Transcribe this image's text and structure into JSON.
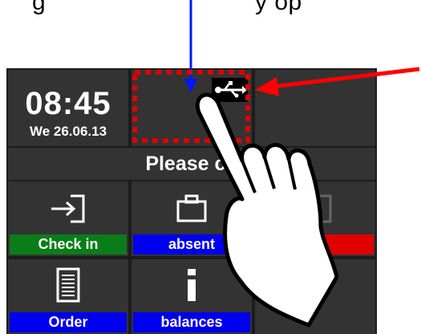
{
  "caption": {
    "left": "g",
    "right": "y op"
  },
  "clock": {
    "time": "08:45",
    "date": "We 26.06.13"
  },
  "banner": {
    "text": "Please ch"
  },
  "tiles": [
    {
      "label": "Check in",
      "icon": "check-in-icon",
      "color": "#0b7d18"
    },
    {
      "label": "absent",
      "icon": "briefcase-icon",
      "color": "#0000ee"
    },
    {
      "label": "",
      "icon": "check-out-icon",
      "color": "#e00000"
    },
    {
      "label": "Order",
      "icon": "document-icon",
      "color": "#0000ee"
    },
    {
      "label": "balances",
      "icon": "info-icon",
      "color": "#0000ee"
    }
  ],
  "status": {
    "usb_icon": "usb-icon"
  },
  "annotations": {
    "arrow_down_color": "#0018ff",
    "arrow_red_color": "#ff0000",
    "highlight_color": "#e00000"
  }
}
